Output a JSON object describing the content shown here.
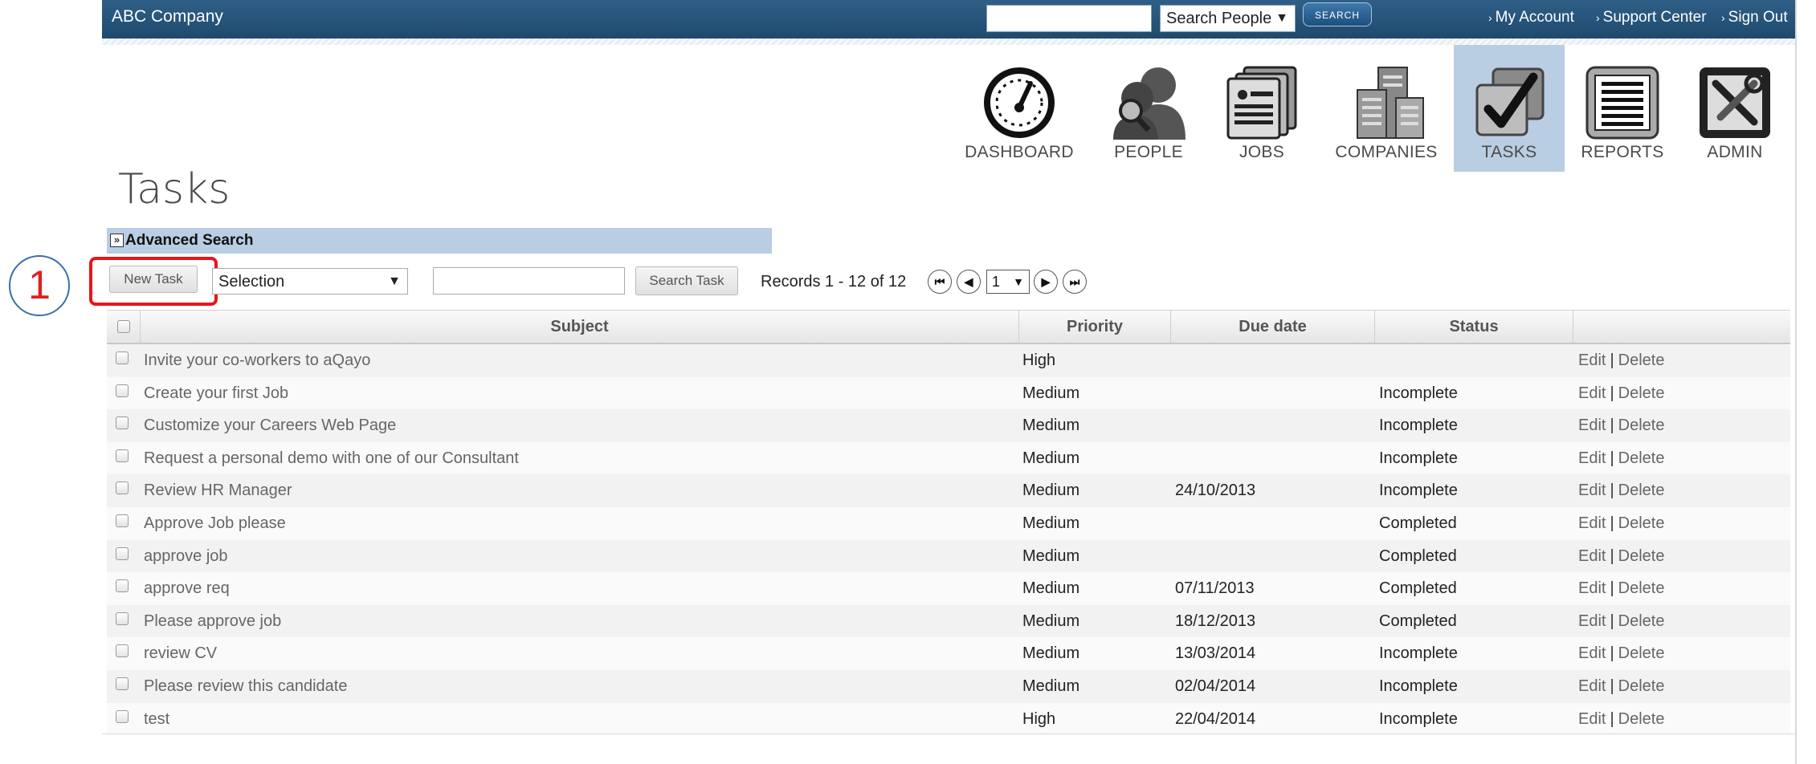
{
  "topbar": {
    "company": "ABC Company",
    "search_select": "Search People",
    "search_button": "SEARCH",
    "links": [
      "My Account",
      "Support Center",
      "Sign Out"
    ]
  },
  "nav": [
    {
      "label": "DASHBOARD",
      "icon": "dashboard-gauge-icon",
      "active": false
    },
    {
      "label": "PEOPLE",
      "icon": "people-icon",
      "active": false
    },
    {
      "label": "JOBS",
      "icon": "jobs-documents-icon",
      "active": false
    },
    {
      "label": "COMPANIES",
      "icon": "companies-buildings-icon",
      "active": false
    },
    {
      "label": "TASKS",
      "icon": "tasks-checkmark-icon",
      "active": true
    },
    {
      "label": "REPORTS",
      "icon": "reports-icon",
      "active": false
    },
    {
      "label": "ADMIN",
      "icon": "admin-tools-icon",
      "active": false
    }
  ],
  "page_title": "Tasks",
  "advanced_search": {
    "toggle": "»",
    "label": "Advanced Search"
  },
  "annotation": {
    "number": "1"
  },
  "toolbar": {
    "new_task": "New Task",
    "selection": "Selection",
    "search_task": "Search Task",
    "records": "Records 1 - 12 of 12",
    "page": "1"
  },
  "table": {
    "headers": [
      "Subject",
      "Priority",
      "Due date",
      "Status",
      ""
    ],
    "edit_label": "Edit",
    "delete_label": "Delete",
    "separator": "|",
    "rows": [
      {
        "subject": "Invite your co-workers to aQayo",
        "priority": "High",
        "due": "",
        "status": ""
      },
      {
        "subject": "Create your first Job",
        "priority": "Medium",
        "due": "",
        "status": "Incomplete"
      },
      {
        "subject": "Customize your Careers Web Page",
        "priority": "Medium",
        "due": "",
        "status": "Incomplete"
      },
      {
        "subject": "Request a personal demo with one of our Consultant",
        "priority": "Medium",
        "due": "",
        "status": "Incomplete"
      },
      {
        "subject": "Review HR Manager",
        "priority": "Medium",
        "due": "24/10/2013",
        "status": "Incomplete"
      },
      {
        "subject": "Approve Job please",
        "priority": "Medium",
        "due": "",
        "status": "Completed"
      },
      {
        "subject": "approve job",
        "priority": "Medium",
        "due": "",
        "status": "Completed"
      },
      {
        "subject": "approve req",
        "priority": "Medium",
        "due": "07/11/2013",
        "status": "Completed"
      },
      {
        "subject": "Please approve job",
        "priority": "Medium",
        "due": "18/12/2013",
        "status": "Completed"
      },
      {
        "subject": "review CV",
        "priority": "Medium",
        "due": "13/03/2014",
        "status": "Incomplete"
      },
      {
        "subject": "Please review this candidate",
        "priority": "Medium",
        "due": "02/04/2014",
        "status": "Incomplete"
      },
      {
        "subject": "test",
        "priority": "High",
        "due": "22/04/2014",
        "status": "Incomplete"
      }
    ]
  }
}
